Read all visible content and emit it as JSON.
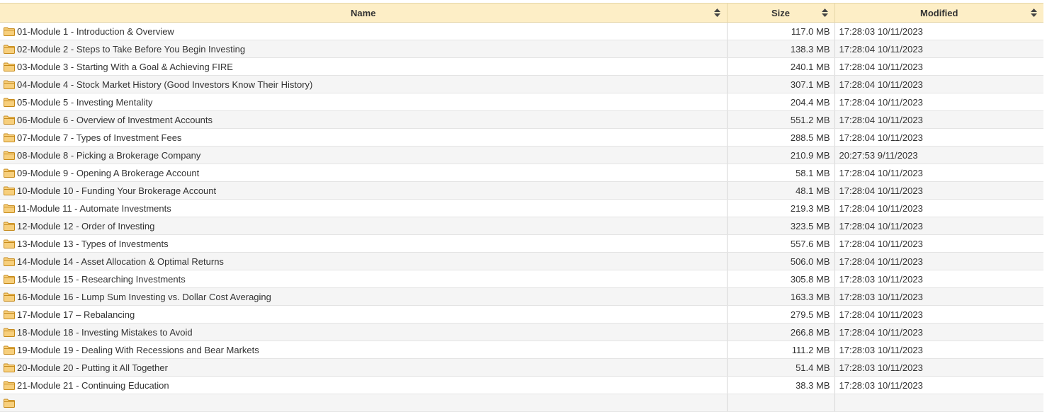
{
  "header": {
    "name_label": "Name",
    "size_label": "Size",
    "modified_label": "Modified"
  },
  "icons": {
    "folder": "folder-icon",
    "sort": "sort-icon"
  },
  "colors": {
    "header_bg": "#fdeec6",
    "folder_fill": "#f7cf7c",
    "folder_stroke": "#c68a1a"
  },
  "rows": [
    {
      "name": "01-Module 1 - Introduction & Overview",
      "size": "117.0 MB",
      "modified": "17:28:03 10/11/2023"
    },
    {
      "name": "02-Module 2 - Steps to Take Before You Begin Investing",
      "size": "138.3 MB",
      "modified": "17:28:04 10/11/2023"
    },
    {
      "name": "03-Module 3 - Starting With a Goal & Achieving FIRE",
      "size": "240.1 MB",
      "modified": "17:28:04 10/11/2023"
    },
    {
      "name": "04-Module 4 - Stock Market History (Good Investors Know Their History)",
      "size": "307.1 MB",
      "modified": "17:28:04 10/11/2023"
    },
    {
      "name": "05-Module 5 - Investing Mentality",
      "size": "204.4 MB",
      "modified": "17:28:04 10/11/2023"
    },
    {
      "name": "06-Module 6 - Overview of Investment Accounts",
      "size": "551.2 MB",
      "modified": "17:28:04 10/11/2023"
    },
    {
      "name": "07-Module 7 - Types of Investment Fees",
      "size": "288.5 MB",
      "modified": "17:28:04 10/11/2023"
    },
    {
      "name": "08-Module 8 - Picking a Brokerage Company",
      "size": "210.9 MB",
      "modified": "20:27:53 9/11/2023"
    },
    {
      "name": "09-Module 9 - Opening A Brokerage Account",
      "size": "58.1 MB",
      "modified": "17:28:04 10/11/2023"
    },
    {
      "name": "10-Module 10 - Funding Your Brokerage Account",
      "size": "48.1 MB",
      "modified": "17:28:04 10/11/2023"
    },
    {
      "name": "11-Module 11 - Automate Investments",
      "size": "219.3 MB",
      "modified": "17:28:04 10/11/2023"
    },
    {
      "name": "12-Module 12 - Order of Investing",
      "size": "323.5 MB",
      "modified": "17:28:04 10/11/2023"
    },
    {
      "name": "13-Module 13 - Types of Investments",
      "size": "557.6 MB",
      "modified": "17:28:04 10/11/2023"
    },
    {
      "name": "14-Module 14 - Asset Allocation & Optimal Returns",
      "size": "506.0 MB",
      "modified": "17:28:04 10/11/2023"
    },
    {
      "name": "15-Module 15 - Researching Investments",
      "size": "305.8 MB",
      "modified": "17:28:03 10/11/2023"
    },
    {
      "name": "16-Module 16 - Lump Sum Investing vs. Dollar Cost Averaging",
      "size": "163.3 MB",
      "modified": "17:28:03 10/11/2023"
    },
    {
      "name": "17-Module 17 – Rebalancing",
      "size": "279.5 MB",
      "modified": "17:28:04 10/11/2023"
    },
    {
      "name": "18-Module 18 - Investing Mistakes to Avoid",
      "size": "266.8 MB",
      "modified": "17:28:04 10/11/2023"
    },
    {
      "name": "19-Module 19 - Dealing With Recessions and Bear Markets",
      "size": "111.2 MB",
      "modified": "17:28:03 10/11/2023"
    },
    {
      "name": "20-Module 20 - Putting it All Together",
      "size": "51.4 MB",
      "modified": "17:28:03 10/11/2023"
    },
    {
      "name": "21-Module 21 - Continuing Education",
      "size": "38.3 MB",
      "modified": "17:28:03 10/11/2023"
    },
    {
      "name": "",
      "size": "",
      "modified": ""
    }
  ]
}
